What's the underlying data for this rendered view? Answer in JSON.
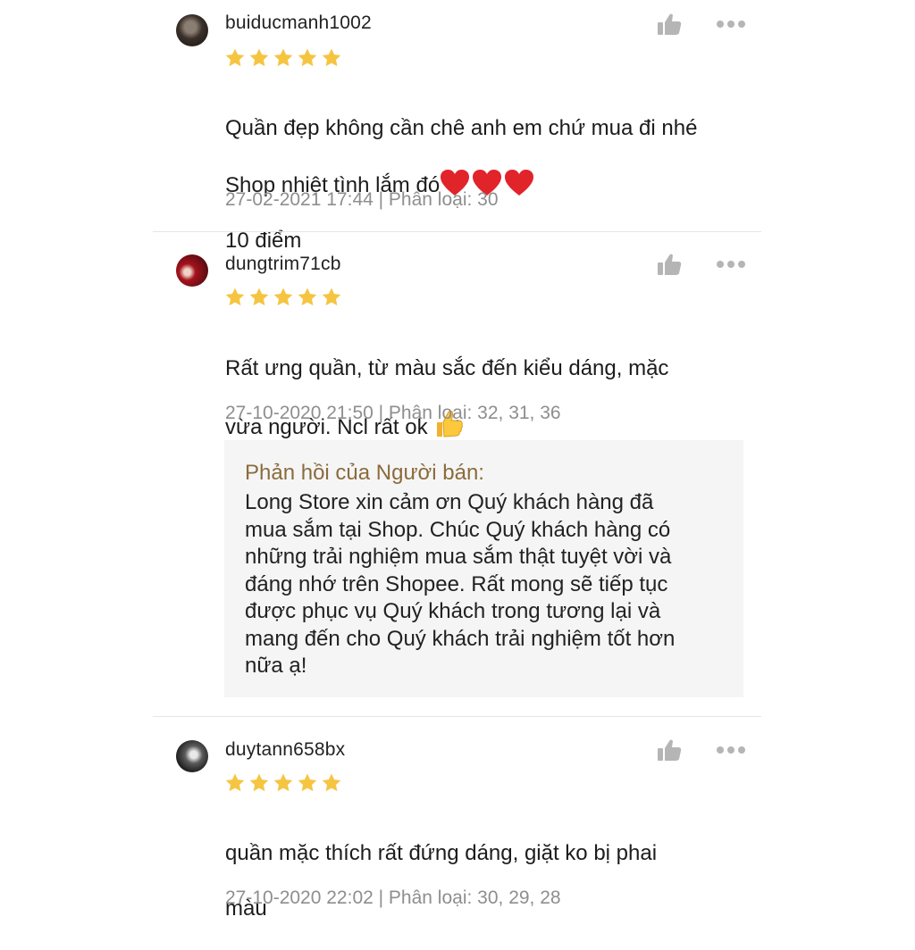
{
  "reviews": [
    {
      "username": "buiducmanh1002",
      "rating": 5,
      "comment_line1": "Quần đẹp không cần chê anh em chứ mua đi nhé",
      "comment_line2": "Shop nhiệt tình lắm đó",
      "comment_line3": "10 điểm",
      "comment_emojis": [
        "heart-emoji",
        "heart-emoji",
        "heart-emoji"
      ],
      "meta": "27-02-2021 17:44 | Phân loại: 30"
    },
    {
      "username": "dungtrim71cb",
      "rating": 5,
      "comment_line1": "Rất ưng quần, từ màu sắc đến kiểu dáng, mặc",
      "comment_line2": "vừa người. Ncl rất ok",
      "comment_emojis": [
        "thumbs-up-emoji"
      ],
      "meta": "27-10-2020 21:50 | Phân loại: 32, 31, 36",
      "seller_reply": {
        "title": "Phản hồi của Người bán:",
        "text": "Long Store xin cảm ơn Quý khách hàng đã\nmua sắm tại Shop. Chúc Quý khách hàng có\nnhững trải nghiệm mua sắm thật tuyệt vời và\nđáng nhớ trên Shopee. Rất mong sẽ tiếp tục\nđược phục vụ Quý khách trong tương lại và\nmang đến cho Quý khách trải nghiệm tốt hơn\nnữa ạ!"
      }
    },
    {
      "username": "duytann658bx",
      "rating": 5,
      "comment_line1": "quần mặc thích rất đứng dáng, giặt ko bị phai",
      "comment_line2": "màu",
      "meta": "27-10-2020 22:02 | Phân loại: 30, 29, 28"
    }
  ],
  "icons": {
    "like": "thumbs-up-icon",
    "more": "more-dots-icon",
    "star": "star-icon"
  },
  "colors": {
    "star": "#f5c542",
    "meta_text": "#8e8e8e",
    "seller_reply_title": "#8b6b3c",
    "reply_background": "#f5f5f5",
    "icon_gray": "#b5b5b5"
  }
}
